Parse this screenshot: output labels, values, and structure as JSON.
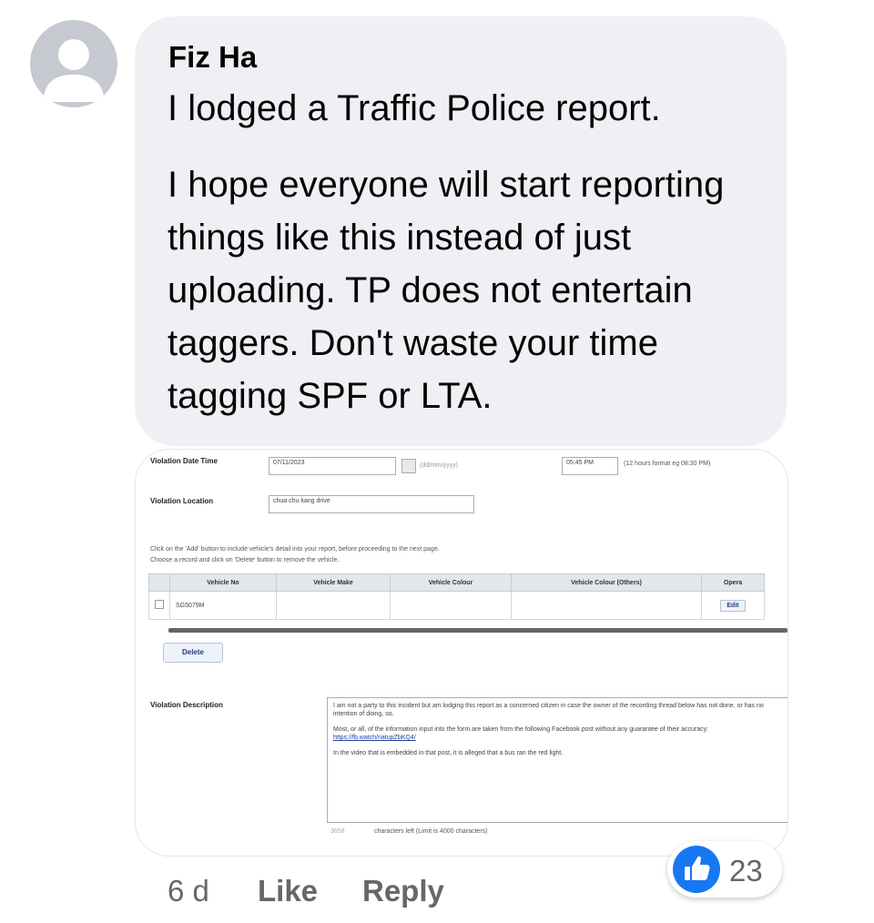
{
  "comment": {
    "author": "Fiz Ha",
    "paragraphs": [
      "I lodged a Traffic Police report.",
      "I hope everyone will start reporting things like this instead of just uploading. TP does not entertain taggers. Don't waste your time tagging SPF or LTA."
    ],
    "time": "6 d",
    "like_label": "Like",
    "reply_label": "Reply",
    "reaction_count": "23",
    "reaction_icon": "thumbs-up-icon"
  },
  "attachment": {
    "violation_date_label": "Violation Date Time",
    "date_value": "07/11/2023",
    "date_format_hint": "(dd/mm/yyyy)",
    "time_value": "05:45 PM",
    "time_format_hint": "(12 hours format eg 08:30 PM)",
    "violation_location_label": "Violation Location",
    "location_value": "chua chu kang drive",
    "instructions_1": "Click on the 'Add' button to include vehicle's detail into your report, before proceeding to the next page.",
    "instructions_2": "Choose a record and click on 'Delete' button to remove the vehicle.",
    "table_headers": [
      "Vehicle No",
      "Vehicle Make",
      "Vehicle Colour",
      "Vehicle Colour (Others)",
      "Opera"
    ],
    "vehicle_no": "SG5079M",
    "edit_label": "Edit",
    "delete_label": "Delete",
    "description_label": "Violation Description",
    "description_p1": "I am not a party to this incident but am lodging this report as a concerned citizen in case the owner of the recording thread below has not done, or has no intention of doing, so.",
    "description_p2": "Most, or all, of the information input into the form are taken from the following Facebook post without any guarantee of their accuracy:",
    "description_link": "https://fb.watch/natupZbKQ4/",
    "description_p3": "In the video that is embedded in that post, it is alleged that a bus ran the red light.",
    "chars_count": "3658",
    "chars_hint": "characters left (Limit is 4000 characters)"
  }
}
